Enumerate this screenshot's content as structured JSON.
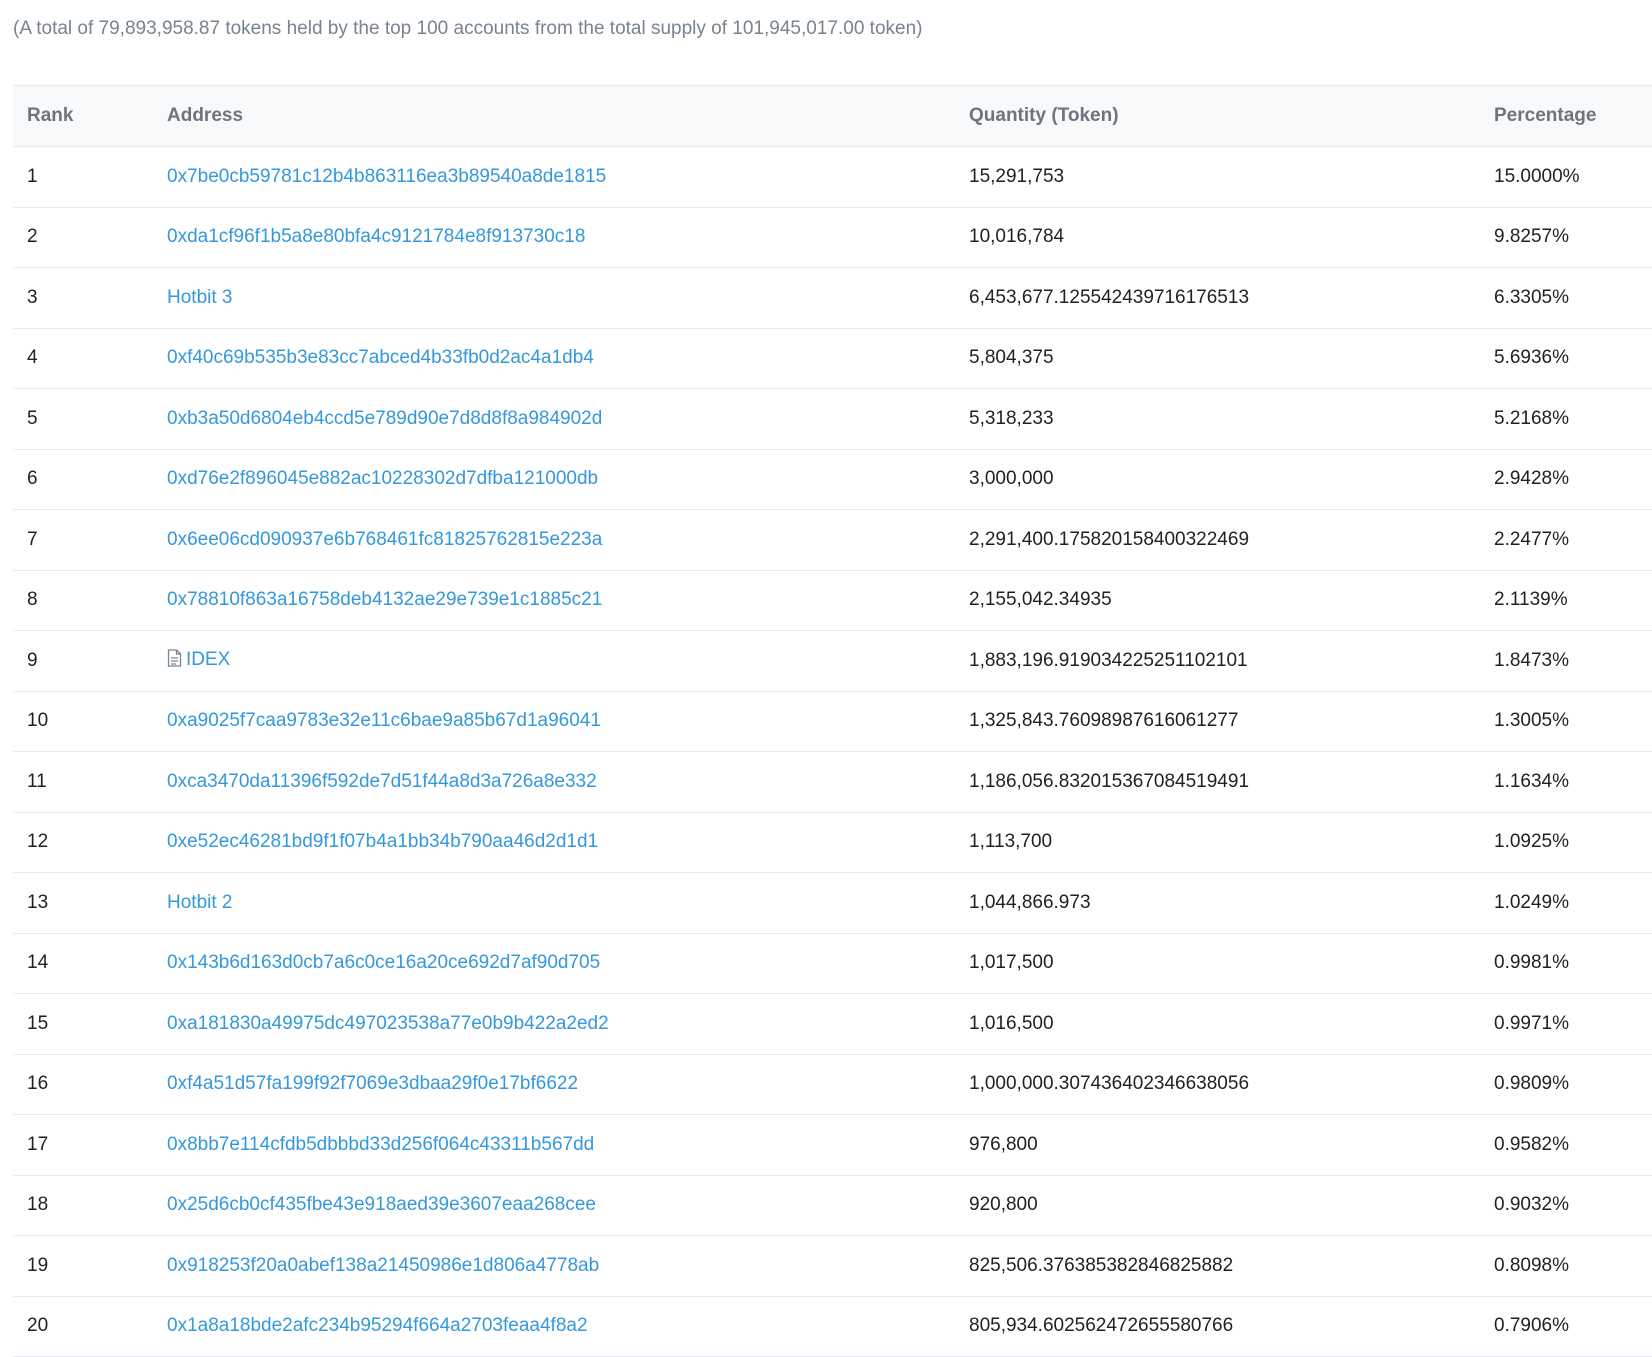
{
  "summary": "(A total of 79,893,958.87 tokens held by the top 100 accounts from the total supply of 101,945,017.00 token)",
  "table": {
    "headers": {
      "rank": "Rank",
      "address": "Address",
      "quantity": "Quantity (Token)",
      "percentage": "Percentage"
    },
    "rows": [
      {
        "rank": "1",
        "address": "0x7be0cb59781c12b4b863116ea3b89540a8de1815",
        "quantity": "15,291,753",
        "percentage": "15.0000%",
        "icon": ""
      },
      {
        "rank": "2",
        "address": "0xda1cf96f1b5a8e80bfa4c9121784e8f913730c18",
        "quantity": "10,016,784",
        "percentage": "9.8257%",
        "icon": ""
      },
      {
        "rank": "3",
        "address": "Hotbit 3",
        "quantity": "6,453,677.125542439716176513",
        "percentage": "6.3305%",
        "icon": ""
      },
      {
        "rank": "4",
        "address": "0xf40c69b535b3e83cc7abced4b33fb0d2ac4a1db4",
        "quantity": "5,804,375",
        "percentage": "5.6936%",
        "icon": ""
      },
      {
        "rank": "5",
        "address": "0xb3a50d6804eb4ccd5e789d90e7d8d8f8a984902d",
        "quantity": "5,318,233",
        "percentage": "5.2168%",
        "icon": ""
      },
      {
        "rank": "6",
        "address": "0xd76e2f896045e882ac10228302d7dfba121000db",
        "quantity": "3,000,000",
        "percentage": "2.9428%",
        "icon": ""
      },
      {
        "rank": "7",
        "address": "0x6ee06cd090937e6b768461fc81825762815e223a",
        "quantity": "2,291,400.175820158400322469",
        "percentage": "2.2477%",
        "icon": ""
      },
      {
        "rank": "8",
        "address": "0x78810f863a16758deb4132ae29e739e1c1885c21",
        "quantity": "2,155,042.34935",
        "percentage": "2.1139%",
        "icon": ""
      },
      {
        "rank": "9",
        "address": "IDEX",
        "quantity": "1,883,196.919034225251102101",
        "percentage": "1.8473%",
        "icon": "contract-file-icon"
      },
      {
        "rank": "10",
        "address": "0xa9025f7caa9783e32e11c6bae9a85b67d1a96041",
        "quantity": "1,325,843.76098987616061277",
        "percentage": "1.3005%",
        "icon": ""
      },
      {
        "rank": "11",
        "address": "0xca3470da11396f592de7d51f44a8d3a726a8e332",
        "quantity": "1,186,056.832015367084519491",
        "percentage": "1.1634%",
        "icon": ""
      },
      {
        "rank": "12",
        "address": "0xe52ec46281bd9f1f07b4a1bb34b790aa46d2d1d1",
        "quantity": "1,113,700",
        "percentage": "1.0925%",
        "icon": ""
      },
      {
        "rank": "13",
        "address": "Hotbit 2",
        "quantity": "1,044,866.973",
        "percentage": "1.0249%",
        "icon": ""
      },
      {
        "rank": "14",
        "address": "0x143b6d163d0cb7a6c0ce16a20ce692d7af90d705",
        "quantity": "1,017,500",
        "percentage": "0.9981%",
        "icon": ""
      },
      {
        "rank": "15",
        "address": "0xa181830a49975dc497023538a77e0b9b422a2ed2",
        "quantity": "1,016,500",
        "percentage": "0.9971%",
        "icon": ""
      },
      {
        "rank": "16",
        "address": "0xf4a51d57fa199f92f7069e3dbaa29f0e17bf6622",
        "quantity": "1,000,000.307436402346638056",
        "percentage": "0.9809%",
        "icon": ""
      },
      {
        "rank": "17",
        "address": "0x8bb7e114cfdb5dbbbd33d256f064c43311b567dd",
        "quantity": "976,800",
        "percentage": "0.9582%",
        "icon": ""
      },
      {
        "rank": "18",
        "address": "0x25d6cb0cf435fbe43e918aed39e3607eaa268cee",
        "quantity": "920,800",
        "percentage": "0.9032%",
        "icon": ""
      },
      {
        "rank": "19",
        "address": "0x918253f20a0abef138a21450986e1d806a4778ab",
        "quantity": "825,506.376385382846825882",
        "percentage": "0.8098%",
        "icon": ""
      },
      {
        "rank": "20",
        "address": "0x1a8a18bde2afc234b95294f664a2703feaa4f8a2",
        "quantity": "805,934.602562472655580766",
        "percentage": "0.7906%",
        "icon": ""
      }
    ]
  },
  "colors": {
    "link": "#3498db",
    "header_bg": "#f8f9fa",
    "border": "#e7eaf3",
    "muted_text": "#77838f"
  }
}
